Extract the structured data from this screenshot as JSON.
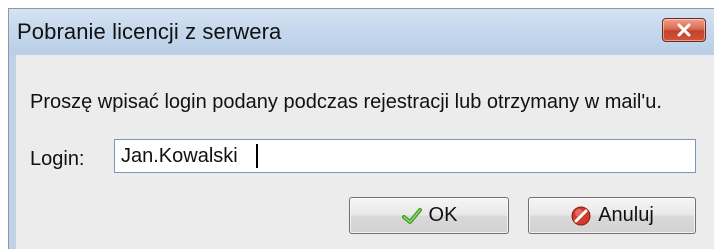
{
  "window": {
    "title": "Pobranie licencji z serwera",
    "close_icon": "close-icon"
  },
  "content": {
    "prompt": "Proszę wpisać login podany podczas rejestracji lub otrzymany w mail'u.",
    "login_label": "Login:",
    "login_value": "Jan.Kowalski"
  },
  "buttons": {
    "ok_label": "OK",
    "ok_icon": "checkmark-icon",
    "cancel_label": "Anuluj",
    "cancel_icon": "cancel-icon"
  },
  "colors": {
    "close_button": "#c2412a",
    "ok_check": "#4aa52b",
    "cancel_icon": "#d23a2a"
  }
}
